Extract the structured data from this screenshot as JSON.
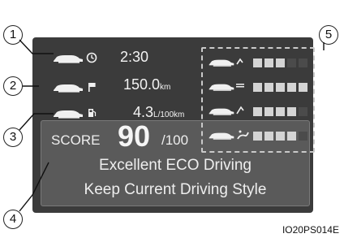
{
  "callouts": [
    "1",
    "2",
    "3",
    "4",
    "5"
  ],
  "rows": [
    {
      "icon": "clock-icon",
      "value": "2:30",
      "unit": ""
    },
    {
      "icon": "flag-icon",
      "value": "150.0",
      "unit": "km"
    },
    {
      "icon": "fuel-icon",
      "value": "4.3",
      "unit": "L/100km"
    }
  ],
  "score": {
    "label": "SCORE",
    "value": "90",
    "max": "/100"
  },
  "messages": [
    "Excellent ECO Driving",
    "Keep Current Driving Style"
  ],
  "eco_ratings": [
    {
      "icon": "start-icon",
      "level": 3,
      "max": 5
    },
    {
      "icon": "cruise-icon",
      "level": 5,
      "max": 5
    },
    {
      "icon": "brake-icon",
      "level": 4,
      "max": 5
    },
    {
      "icon": "ac-icon",
      "level": 4,
      "max": 5
    }
  ],
  "figure_id": "IO20PS014E"
}
